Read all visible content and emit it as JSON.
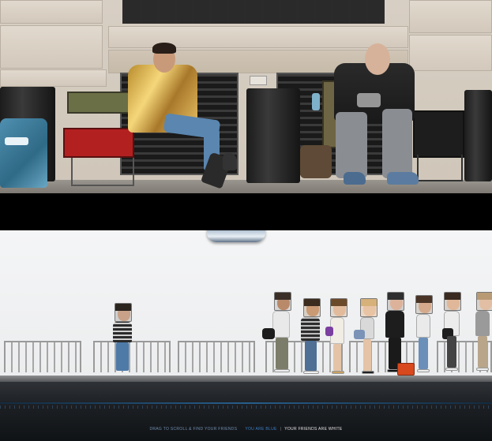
{
  "bottom_bar": {
    "instruction": "DRAG TO SCROLL & FIND YOUR FRIENDS",
    "you_label": "YOU ARE BLUE",
    "separator": "|",
    "friends_label": "YOUR FRIENDS ARE WHITE"
  },
  "colors": {
    "you_blue": "#3c7fc2",
    "friends_white": "#e6e6e6",
    "instruction_text": "#6f8eae"
  },
  "queue": {
    "you": {
      "face": "portrait",
      "shirt": "striped"
    },
    "friends": [
      {
        "face": "bearded-man"
      },
      {
        "face": "smiling-man"
      },
      {
        "face": "woman-blonde"
      },
      {
        "face": "woman-smiling"
      },
      {
        "face": "man-suit"
      },
      {
        "face": "man-glasses"
      },
      {
        "face": "woman-sunglasses"
      },
      {
        "face": "woman-grey"
      }
    ]
  }
}
